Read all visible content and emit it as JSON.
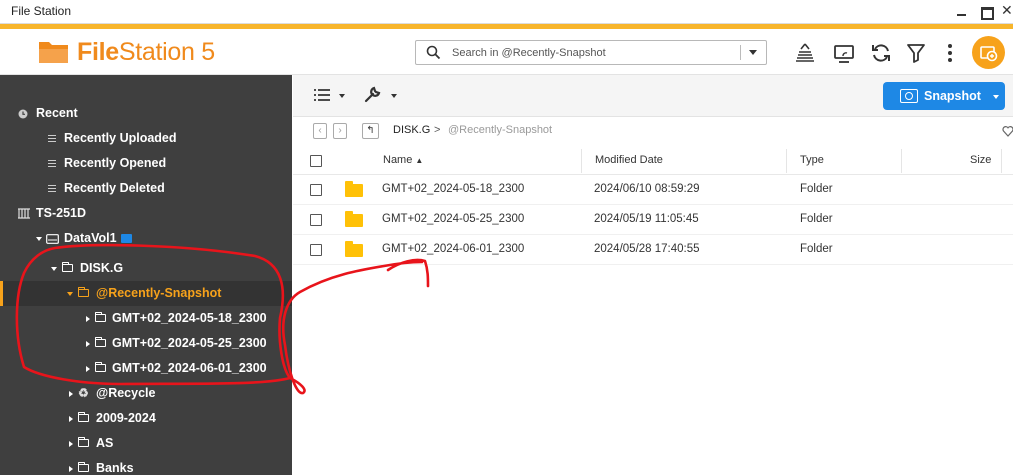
{
  "window": {
    "title": "File Station"
  },
  "app": {
    "name_bold": "File",
    "name_rest": "Station 5"
  },
  "search": {
    "placeholder": "Search in @Recently-Snapshot"
  },
  "sidebar": {
    "recent": {
      "label": "Recent",
      "items": [
        "Recently Uploaded",
        "Recently Opened",
        "Recently Deleted"
      ]
    },
    "device": "TS-251D",
    "volume": "DataVol1",
    "share": "DISK.G",
    "selected": "@Recently-Snapshot",
    "snapshots": [
      "GMT+02_2024-05-18_2300",
      "GMT+02_2024-05-25_2300",
      "GMT+02_2024-06-01_2300"
    ],
    "others": [
      "@Recycle",
      "2009-2024",
      "AS",
      "Banks"
    ]
  },
  "toolbar": {
    "snapshot_label": "Snapshot"
  },
  "breadcrumb": {
    "disk": "DISK.G",
    "separator": ">",
    "current": "@Recently-Snapshot"
  },
  "table": {
    "headers": {
      "name": "Name",
      "modified": "Modified Date",
      "type": "Type",
      "size": "Size"
    },
    "rows": [
      {
        "name": "GMT+02_2024-05-18_2300",
        "modified": "2024/06/10 08:59:29",
        "type": "Folder"
      },
      {
        "name": "GMT+02_2024-05-25_2300",
        "modified": "2024/05/19 11:05:45",
        "type": "Folder"
      },
      {
        "name": "GMT+02_2024-06-01_2300",
        "modified": "2024/05/28 17:40:55",
        "type": "Folder"
      }
    ]
  },
  "colors": {
    "accent": "#f7a21b",
    "brand": "#f08a1c",
    "primary_button": "#1e88e5",
    "sidebar_bg": "#3f3f3f",
    "annotation": "#e8141b"
  },
  "icons": {
    "header": [
      "upload-queue-icon",
      "media-streaming-icon",
      "refresh-icon",
      "filter-icon",
      "more-vertical-icon",
      "user-icon"
    ]
  }
}
